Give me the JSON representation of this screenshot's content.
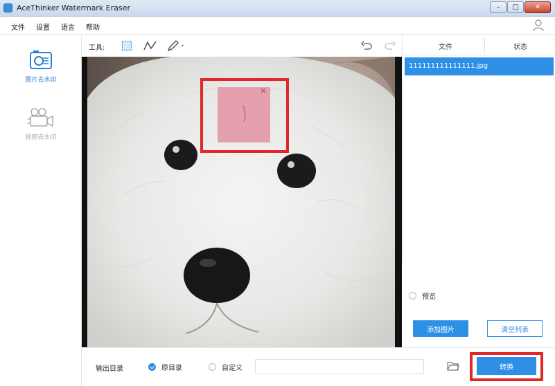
{
  "window": {
    "title": "AceThinker Watermark Eraser",
    "minimize": "–",
    "maximize": "□",
    "close": "✕"
  },
  "menu": {
    "file": "文件",
    "settings": "设置",
    "language": "语言",
    "help": "帮助"
  },
  "sidebar": {
    "image_tab": "图片去水印",
    "video_tab": "视频去水印"
  },
  "toolbar": {
    "tools_label": "工具:"
  },
  "file_panel": {
    "col_file": "文件",
    "col_status": "状态",
    "files": [
      {
        "name": "111111111111111.jpg"
      }
    ],
    "preview_label": "预览",
    "add_image": "添加图片",
    "clear_list": "清空列表"
  },
  "bottom": {
    "output_label": "输出目录",
    "opt_original": "原目录",
    "opt_custom": "自定义",
    "path_value": "",
    "convert": "转换"
  },
  "colors": {
    "accent": "#2e8fe6",
    "highlight": "#e0282b",
    "watermark": "#e5a0ad"
  }
}
